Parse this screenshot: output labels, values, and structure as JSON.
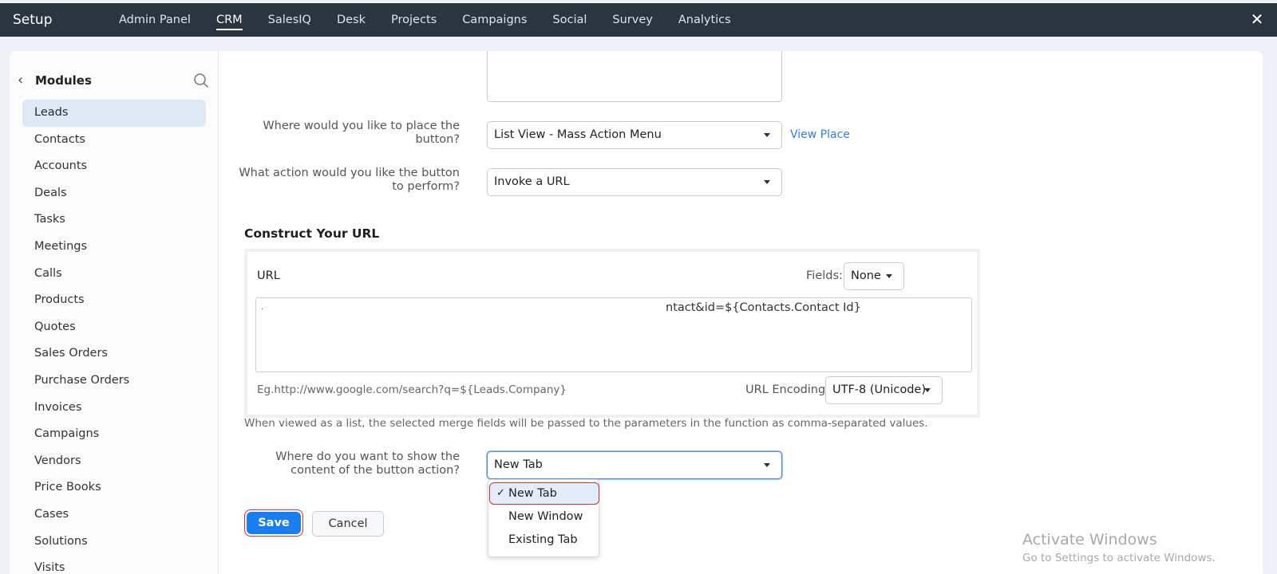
{
  "topbar": {
    "brand": "Setup",
    "nav": [
      "Admin Panel",
      "CRM",
      "SalesIQ",
      "Desk",
      "Projects",
      "Campaigns",
      "Social",
      "Survey",
      "Analytics"
    ],
    "active": "CRM"
  },
  "sidebar": {
    "title": "Modules",
    "items": [
      "Leads",
      "Contacts",
      "Accounts",
      "Deals",
      "Tasks",
      "Meetings",
      "Calls",
      "Products",
      "Quotes",
      "Sales Orders",
      "Purchase Orders",
      "Invoices",
      "Campaigns",
      "Vendors",
      "Price Books",
      "Cases",
      "Solutions",
      "Visits"
    ],
    "active": "Leads"
  },
  "form": {
    "place_question": "Where would you like to place the button?",
    "place_value": "List View - Mass Action Menu",
    "view_place_link": "View Place",
    "action_question": "What action would you like the button to perform?",
    "action_value": "Invoke a URL",
    "section_title": "Construct Your URL",
    "url_label": "URL",
    "fields_label": "Fields:",
    "fields_value": "None",
    "url_text_start": ".",
    "url_text": "ntact&id=${Contacts.Contact Id}",
    "example": "Eg.http://www.google.com/search?q=${Leads.Company}",
    "encoding_label": "URL Encoding:",
    "encoding_value": "UTF-8 (Unicode)",
    "hint": "When viewed as a list, the selected merge fields will be passed to the parameters in the function as comma-separated values.",
    "show_question": "Where do you want to show the content of the button action?",
    "show_value": "New Tab",
    "show_options": [
      "New Tab",
      "New Window",
      "Existing Tab"
    ],
    "save_label": "Save",
    "cancel_label": "Cancel"
  },
  "watermark": {
    "line1": "Activate Windows",
    "line2": "Go to Settings to activate Windows."
  },
  "colors": {
    "topbar": "#2b3441",
    "accent": "#1a7ef0",
    "highlight": "#d32f2f",
    "link": "#2f7ee0"
  }
}
